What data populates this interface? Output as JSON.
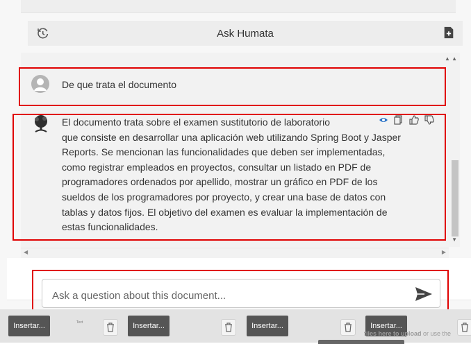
{
  "header": {
    "title": "Ask Humata",
    "history_icon": "history-icon",
    "add_icon": "file-add-icon"
  },
  "chat": {
    "user_message": "De que trata el documento",
    "assistant_message_lines": [
      "El documento trata sobre el examen sustitutorio de laboratorio",
      "que consiste en desarrollar una aplicación web utilizando Spring Boot y Jasper",
      "Reports. Se mencionan las funcionalidades que deben ser implementadas,",
      "como registrar empleados en proyectos, consultar un listado en PDF de",
      "programadores ordenados por apellido, mostrar un gráfico en PDF de los",
      "sueldos de los programadores por proyecto, y crear una base de datos con",
      "tablas y datos fijos. El objetivo del examen es evaluar la implementación de",
      "estas funcionalidades."
    ],
    "action_icons": [
      "eye-icon",
      "copy-icon",
      "thumbs-up-icon",
      "thumbs-down-icon"
    ]
  },
  "composer": {
    "placeholder": "Ask a question about this document...",
    "send_icon": "send-icon"
  },
  "bottom_bar": {
    "insert_label": "Insertar...",
    "upload_hint_bold": "files here to upload",
    "upload_hint_rest": " or use the",
    "tiny_text": "Text"
  },
  "colors": {
    "highlight_border": "#e00000",
    "insert_button": "#555555"
  }
}
